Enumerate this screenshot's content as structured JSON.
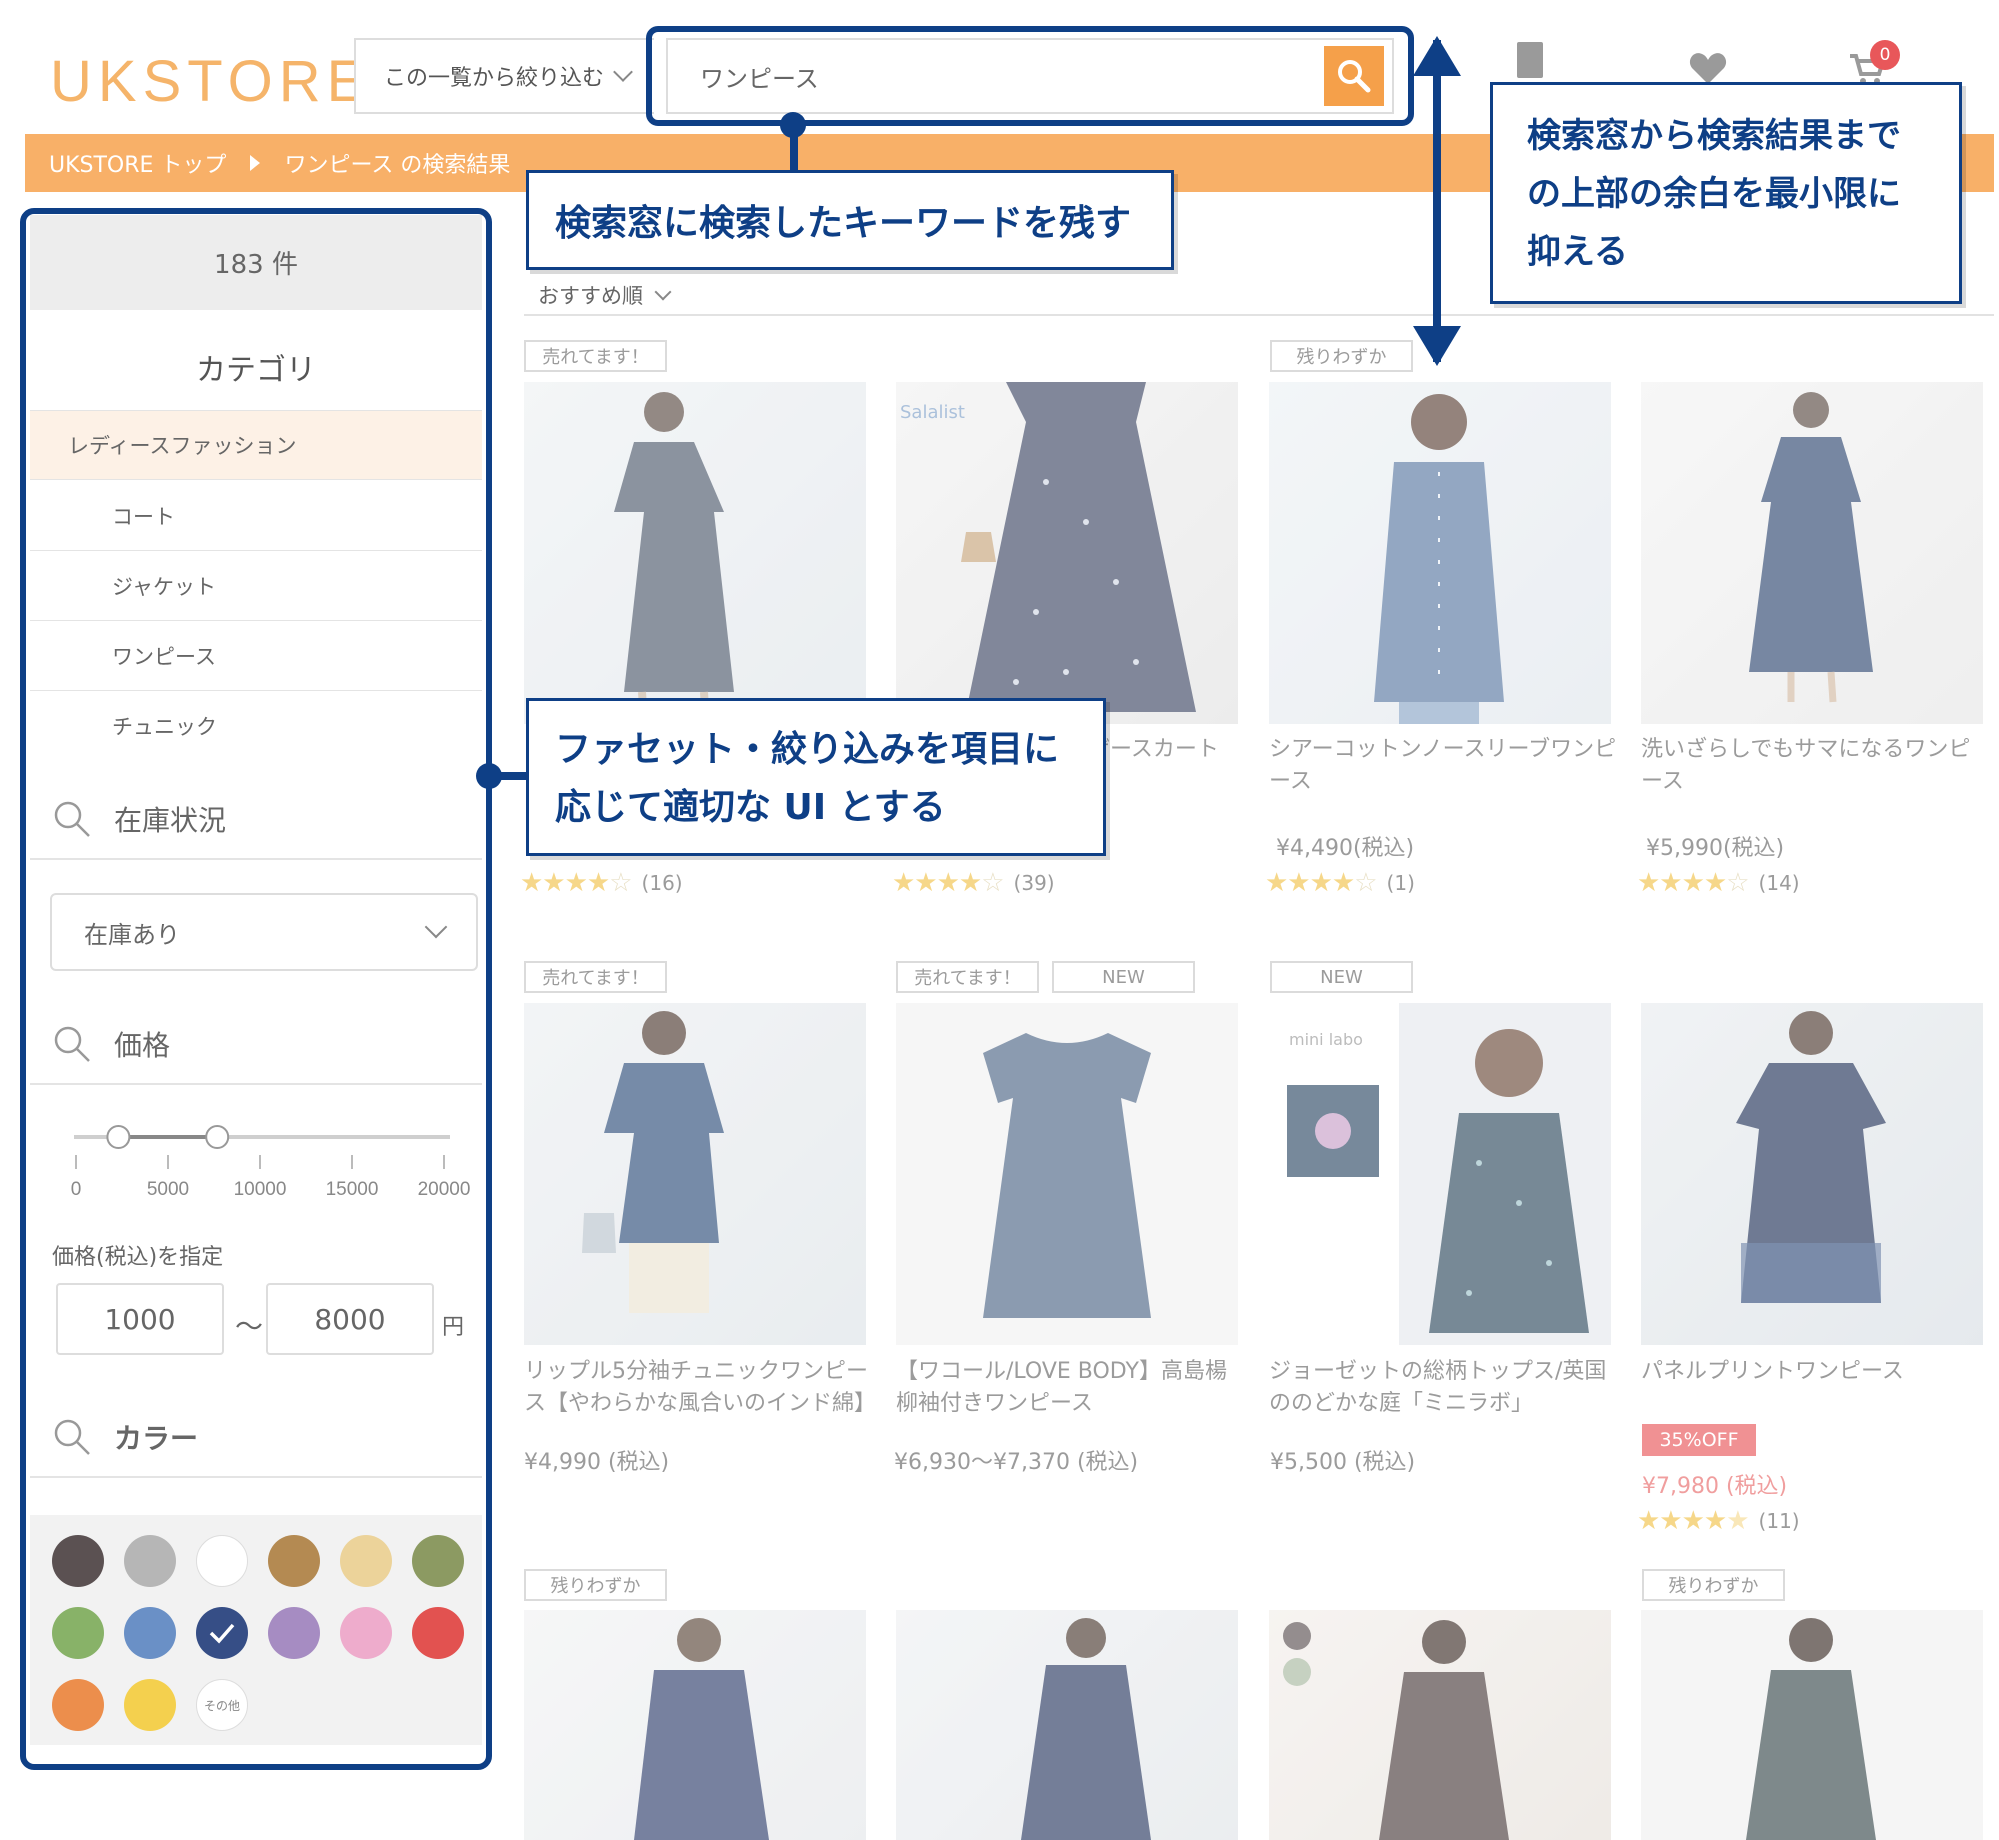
{
  "header": {
    "logo": "UKSTORE",
    "filter_select": "この一覧から絞り込む",
    "search_value": "ワンピース",
    "cart_count": "0"
  },
  "breadcrumb": {
    "home": "UKSTORE トップ",
    "current": "ワンピース の検索結果"
  },
  "sidebar": {
    "count": "183 件",
    "category_title": "カテゴリ",
    "categories": [
      "レディースファッション",
      "コート",
      "ジャケット",
      "ワンピース",
      "チュニック"
    ],
    "stock_title": "在庫状況",
    "stock_value": "在庫あり",
    "price_title": "価格",
    "slider_ticks": [
      "0",
      "5000",
      "10000",
      "15000",
      "20000"
    ],
    "slider_min": 1000,
    "slider_max": 8000,
    "slider_range_max": 20000,
    "price_label": "価格(税込)を指定",
    "price_min": "1000",
    "price_sep": "～",
    "price_max": "8000",
    "price_unit": "円",
    "color_title": "カラー",
    "colors": [
      "#5b5152",
      "#b6b6b6",
      "#ffffff",
      "#b48a52",
      "#ecd39a",
      "#8c9a62",
      "#88b268",
      "#6a90c6",
      "#364e86",
      "#a68cc2",
      "#eeaccc",
      "#e25250",
      "#ec8e4c",
      "#f4d04e"
    ],
    "color_other": "その他"
  },
  "sort": {
    "label": "おすすめ順"
  },
  "products": [
    {
      "badges": [
        "売れてます！"
      ],
      "name": "",
      "price": "",
      "rating": 4,
      "reviews": "(16)"
    },
    {
      "badges": [],
      "name": "ザースカート",
      "price": "",
      "rating": 4,
      "reviews": "(39)",
      "brand": "Salalist"
    },
    {
      "badges": [
        "残りわずか"
      ],
      "name": "シアーコットンノースリーブワンピース",
      "price": "¥4,490(税込)",
      "rating": 4,
      "reviews": "(1)"
    },
    {
      "badges": [],
      "name": "洗いざらしでもサマになるワンピース",
      "price": "¥5,990(税込)",
      "rating": 4,
      "reviews": "(14)"
    },
    {
      "badges": [
        "売れてます！"
      ],
      "name": "リップル5分袖チュニックワンピース【やわらかな風合いのインド綿】",
      "price": "¥4,990 (税込)"
    },
    {
      "badges": [
        "売れてます！",
        "NEW"
      ],
      "name": "【ワコール/LOVE BODY】高島楊柳袖付きワンピース",
      "price": "¥6,930〜¥7,370 (税込)"
    },
    {
      "badges": [
        "NEW"
      ],
      "name": "ジョーゼットの総柄トップス/英国ののどかな庭「ミニラボ」",
      "price": "¥5,500 (税込)",
      "brand": "mini labo"
    },
    {
      "badges": [],
      "name": "パネルプリントワンピース",
      "off": "35%OFF",
      "price": "¥7,980 (税込)",
      "rating": 4.5,
      "reviews": "(11)"
    },
    {
      "badges": [
        "残りわずか"
      ]
    },
    {
      "badges": []
    },
    {
      "badges": []
    },
    {
      "badges": [
        "残りわずか"
      ]
    }
  ],
  "callouts": {
    "search_keep": "検索窓に検索したキーワードを残す",
    "top_margin": [
      "検索窓から検索結果まで",
      "の上部の余白を最小限に",
      "抑える"
    ],
    "facet_ui": [
      "ファセット・絞り込みを項目に",
      "応じて適切な UI とする"
    ]
  }
}
